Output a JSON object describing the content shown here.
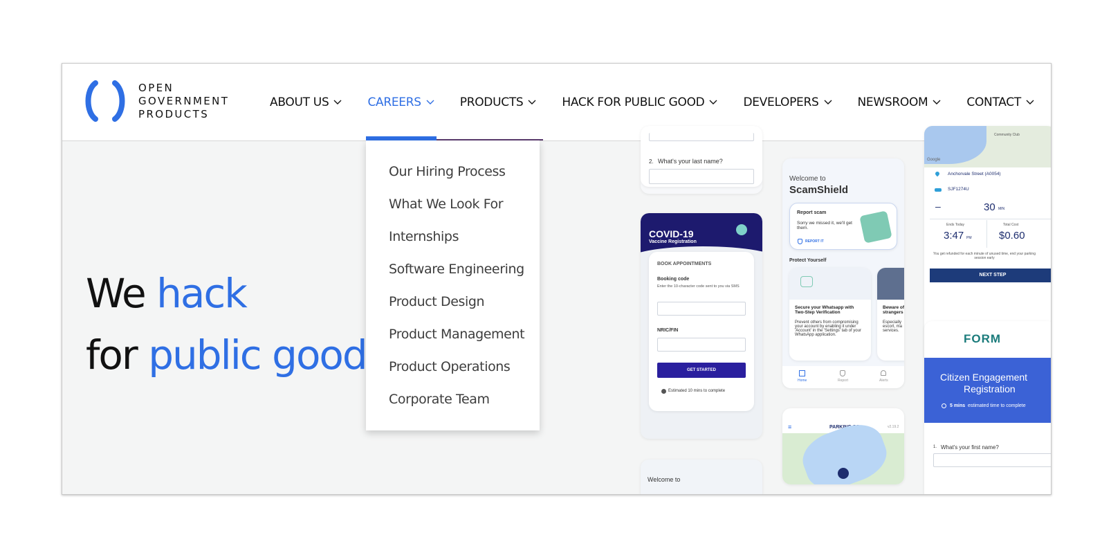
{
  "brand": {
    "logo_line1": "OPEN",
    "logo_line2": "GOVERNMENT",
    "logo_line3": "PRODUCTS",
    "accent_color": "#2f6fe4"
  },
  "nav": {
    "items": [
      {
        "label": "ABOUT US",
        "active": false
      },
      {
        "label": "CAREERS",
        "active": true
      },
      {
        "label": "PRODUCTS",
        "active": false
      },
      {
        "label": "HACK FOR PUBLIC GOOD",
        "active": false
      },
      {
        "label": "DEVELOPERS",
        "active": false
      },
      {
        "label": "NEWSROOM",
        "active": false
      },
      {
        "label": "CONTACT",
        "active": false
      }
    ]
  },
  "dropdown": {
    "items": [
      "Our Hiring Process",
      "What We Look For",
      "Internships",
      "Software Engineering",
      "Product Design",
      "Product Management",
      "Product Operations",
      "Corporate Team"
    ]
  },
  "hero": {
    "line1_plain": "We ",
    "line1_blue": "hack",
    "line2_plain": "for ",
    "line2_blue": "public good"
  },
  "mock_form": {
    "question2": "What's your last name?",
    "question2_num": "2."
  },
  "mock_covid": {
    "title": "COVID-19",
    "subtitle": "Vaccine Registration",
    "section": "BOOK APPOINTMENTS",
    "booking_label": "Booking code",
    "booking_hint": "Enter the 10-character code sent to you via SMS",
    "nric_label": "NRIC/FIN",
    "cta": "GET STARTED",
    "estimate": "Estimated 10 mins to complete"
  },
  "mock_scamshield": {
    "welcome": "Welcome to",
    "title": "ScamShield",
    "card_title": "Report scam",
    "card_body": "Sorry we missed it, we'll get them.",
    "card_link": "REPORT IT",
    "section": "Protect Yourself",
    "tip_title": "Secure your Whatsapp with Two-Step Verification",
    "tip_body": "Prevent others from compromising your account by enabling it under 'Account' in the 'Settings' tab of your WhatsApp application.",
    "tip2_title": "Beware of strangers",
    "tip2_body": "Especially escort, ma services.",
    "tabs": [
      "Home",
      "Report",
      "Alerts"
    ]
  },
  "mock_parking": {
    "map_label": "Community Club",
    "google": "Google",
    "location": "Anchorvale Street (A0054)",
    "vehicle": "SJF1274U",
    "minus": "–",
    "duration": "30",
    "duration_unit": "MIN",
    "ends_label": "Ends Today",
    "ends_value": "3:47",
    "ends_unit": "PM",
    "cost_label": "Total Cost",
    "cost_value": "$0.60",
    "refund_note": "You get refunded for each minute of unused time, end your parking session early",
    "cta": "NEXT STEP"
  },
  "mock_parking2": {
    "title": "PARKING.SG",
    "version": "v2.19.2"
  },
  "mock_formsg": {
    "logo": "FORM",
    "title_line1": "Citizen Engagement",
    "title_line2": "Registration",
    "time_bold": "5 mins",
    "time_rest": "estimated time to complete",
    "question1_num": "1.",
    "question1": "What's your first name?"
  },
  "mock_bottom": {
    "text": "Welcome to"
  }
}
